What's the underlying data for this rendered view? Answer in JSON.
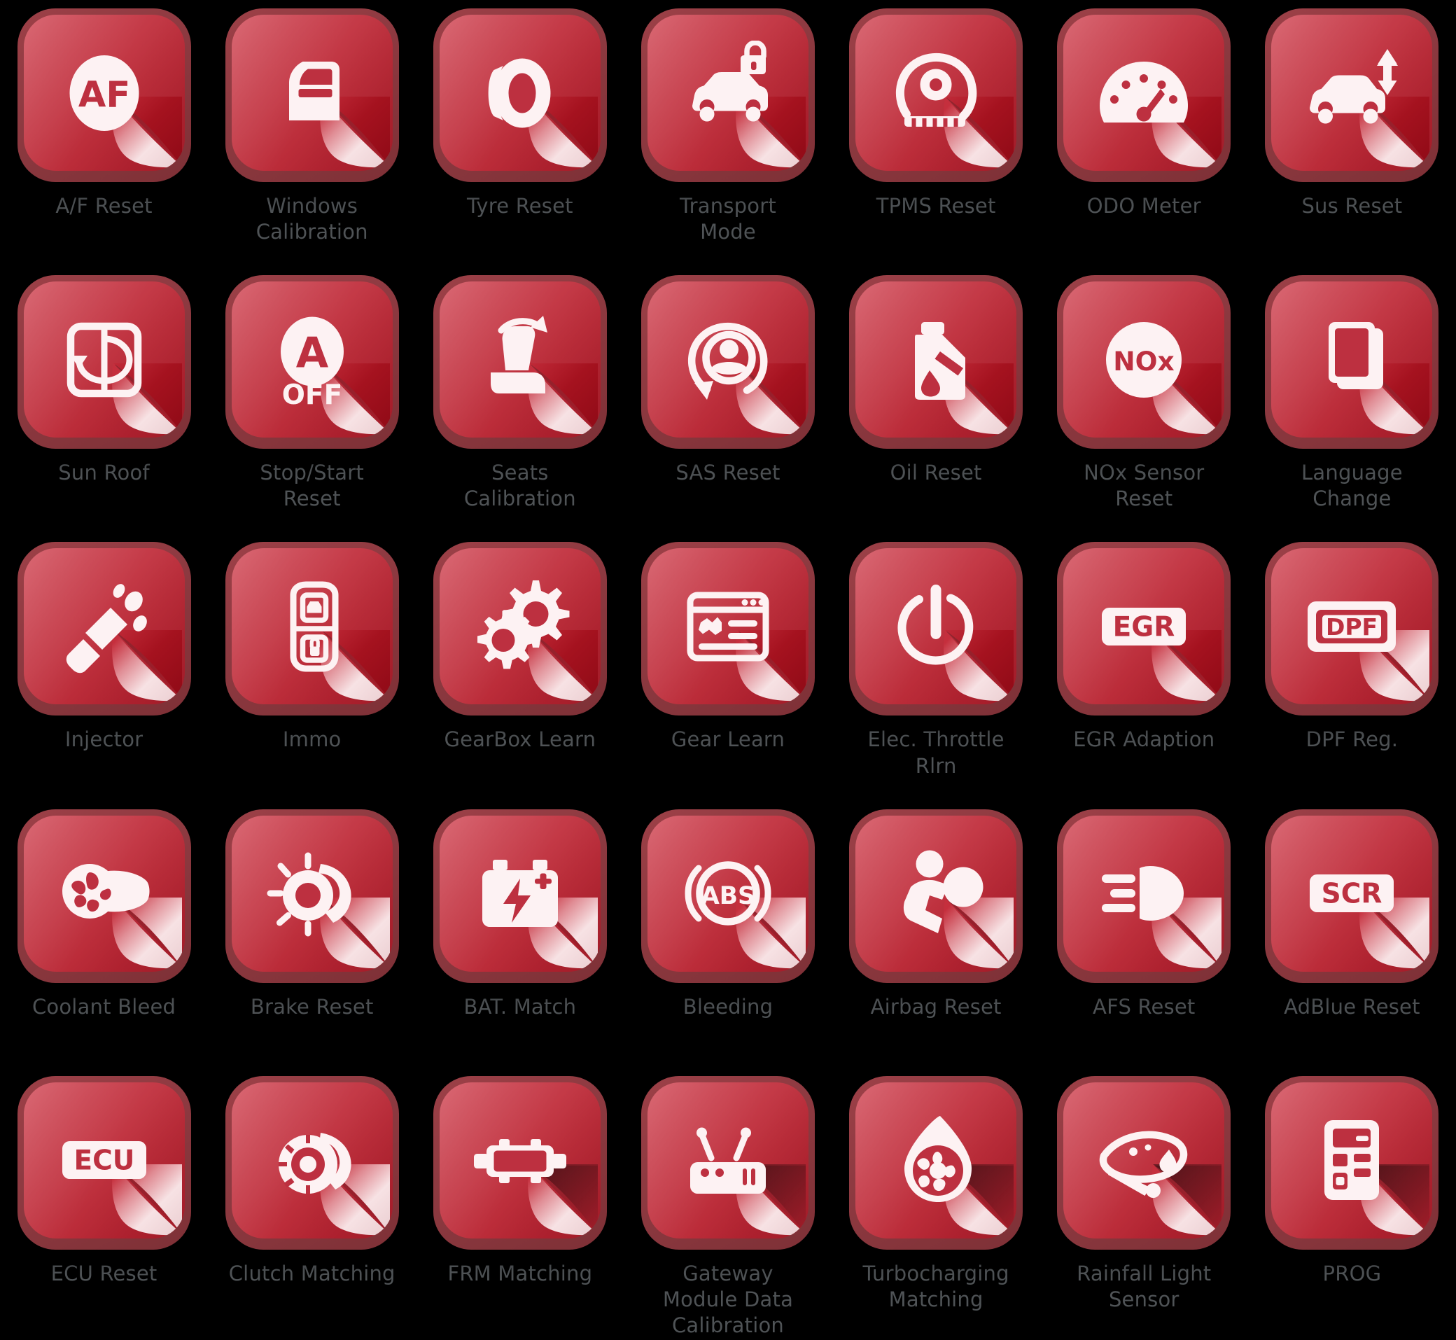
{
  "theme": {
    "background": "#000000",
    "tile_bezel": "#8e3a41",
    "tile_face_top": "#d4525f",
    "tile_face_bottom": "#ab1d2a",
    "glyph_color": "#fdf2f3",
    "label_color": "#4f5356",
    "curl_highlight": "#f2d3d6"
  },
  "grid": {
    "columns": 7,
    "rows": 5
  },
  "tiles": [
    {
      "label": "A/F Reset",
      "icon": "af-circle-icon"
    },
    {
      "label": "Windows\nCalibration",
      "icon": "car-door-window-icon"
    },
    {
      "label": "Tyre Reset",
      "icon": "tyre-icon"
    },
    {
      "label": "Transport\nMode",
      "icon": "car-transport-lock-icon"
    },
    {
      "label": "TPMS Reset",
      "icon": "tyre-pressure-sensor-icon"
    },
    {
      "label": "ODO Meter",
      "icon": "odometer-gauge-icon"
    },
    {
      "label": "Sus Reset",
      "icon": "car-suspension-arrows-icon"
    },
    {
      "label": "Sun Roof",
      "icon": "sunroof-rotate-icon"
    },
    {
      "label": "Stop/Start\nReset",
      "icon": "a-off-autostop-icon"
    },
    {
      "label": "Seats Calibration",
      "icon": "seat-rotate-icon"
    },
    {
      "label": "SAS Reset",
      "icon": "steering-angle-sensor-icon"
    },
    {
      "label": "Oil Reset",
      "icon": "oil-can-drop-icon"
    },
    {
      "label": "NOx Sensor\nReset",
      "icon": "nox-circle-icon"
    },
    {
      "label": "Language\nChange",
      "icon": "language-book-a-icon"
    },
    {
      "label": "Injector",
      "icon": "fuel-injector-spray-icon"
    },
    {
      "label": "Immo",
      "icon": "immobilizer-key-fob-icon"
    },
    {
      "label": "GearBox Learn",
      "icon": "double-gear-icon"
    },
    {
      "label": "Gear Learn",
      "icon": "gear-window-list-icon"
    },
    {
      "label": "Elec. Throttle\nRlrn",
      "icon": "electronic-throttle-body-icon"
    },
    {
      "label": "EGR Adaption",
      "icon": "egr-badge-icon"
    },
    {
      "label": "DPF Reg.",
      "icon": "dpf-badge-icon"
    },
    {
      "label": "Coolant Bleed",
      "icon": "coolant-pump-icon"
    },
    {
      "label": "Brake Reset",
      "icon": "brake-disc-pad-icon"
    },
    {
      "label": "BAT. Match",
      "icon": "battery-bolt-icon"
    },
    {
      "label": "Bleeding",
      "icon": "abs-brake-icon"
    },
    {
      "label": "Airbag Reset",
      "icon": "airbag-occupant-icon"
    },
    {
      "label": "AFS Reset",
      "icon": "headlight-beam-icon"
    },
    {
      "label": "AdBlue Reset",
      "icon": "scr-badge-icon"
    },
    {
      "label": "ECU Reset",
      "icon": "ecu-badge-icon"
    },
    {
      "label": "Clutch Matching",
      "icon": "clutch-disc-icon"
    },
    {
      "label": "FRM Matching",
      "icon": "frm-module-icon"
    },
    {
      "label": "Gateway\nModule Data\nCalibration",
      "icon": "gateway-module-antenna-icon"
    },
    {
      "label": "Turbocharging\nMatching",
      "icon": "turbocharger-drop-icon"
    },
    {
      "label": "Rainfall Light\nSensor",
      "icon": "rain-light-sensor-icon"
    },
    {
      "label": "PROG",
      "icon": "programmer-device-icon"
    }
  ]
}
